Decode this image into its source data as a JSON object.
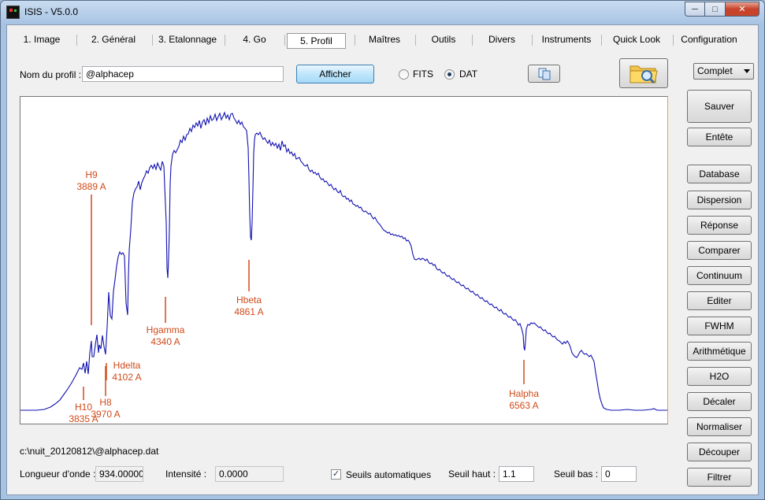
{
  "window": {
    "title": "ISIS - V5.0.0"
  },
  "tabs": [
    {
      "label": "1. Image",
      "active": false
    },
    {
      "label": "2. Général",
      "active": false
    },
    {
      "label": "3. Etalonnage",
      "active": false
    },
    {
      "label": "4. Go",
      "active": false
    },
    {
      "label": "5. Profil",
      "active": true
    },
    {
      "label": "Maîtres",
      "active": false
    },
    {
      "label": "Outils",
      "active": false
    },
    {
      "label": "Divers",
      "active": false
    },
    {
      "label": "Instruments",
      "active": false
    },
    {
      "label": "Quick Look",
      "active": false
    },
    {
      "label": "Configuration",
      "active": false
    }
  ],
  "profile": {
    "name_label": "Nom du profil :",
    "name_value": "@alphacep",
    "show_button": "Afficher",
    "format_fits": "FITS",
    "format_dat": "DAT",
    "format_selected": "DAT"
  },
  "mode_select": {
    "value": "Complet"
  },
  "side_buttons": {
    "top": [
      "Sauver",
      "Entête"
    ],
    "list": [
      "Database",
      "Dispersion",
      "Réponse",
      "Comparer",
      "Continuum",
      "Editer",
      "FWHM",
      "Arithmétique",
      "H2O",
      "Décaler",
      "Normaliser",
      "Découper",
      "Filtrer"
    ]
  },
  "spectrum": {
    "line_color": "#1010b0",
    "marker_color": "#d04a1a",
    "lines": [
      {
        "name": "H9",
        "wavelength": "3889 A"
      },
      {
        "name": "H10",
        "wavelength": "3835 A"
      },
      {
        "name": "H8",
        "wavelength": "3970 A"
      },
      {
        "name": "Hdelta",
        "wavelength": "4102 A"
      },
      {
        "name": "Hgamma",
        "wavelength": "4340 A"
      },
      {
        "name": "Hbeta",
        "wavelength": "4861 A"
      },
      {
        "name": "Halpha",
        "wavelength": "6563 A"
      }
    ]
  },
  "status": {
    "file_path": "c:\\nuit_20120812\\@alphacep.dat",
    "wavelength_label": "Longueur d'onde :",
    "wavelength_value": "934.000000",
    "intensity_label": "Intensité :",
    "intensity_value": "0.0000",
    "auto_thresholds_label": "Seuils automatiques",
    "auto_thresholds_checked": true,
    "high_label": "Seuil haut :",
    "high_value": "1.1",
    "low_label": "Seuil bas :",
    "low_value": "0"
  }
}
